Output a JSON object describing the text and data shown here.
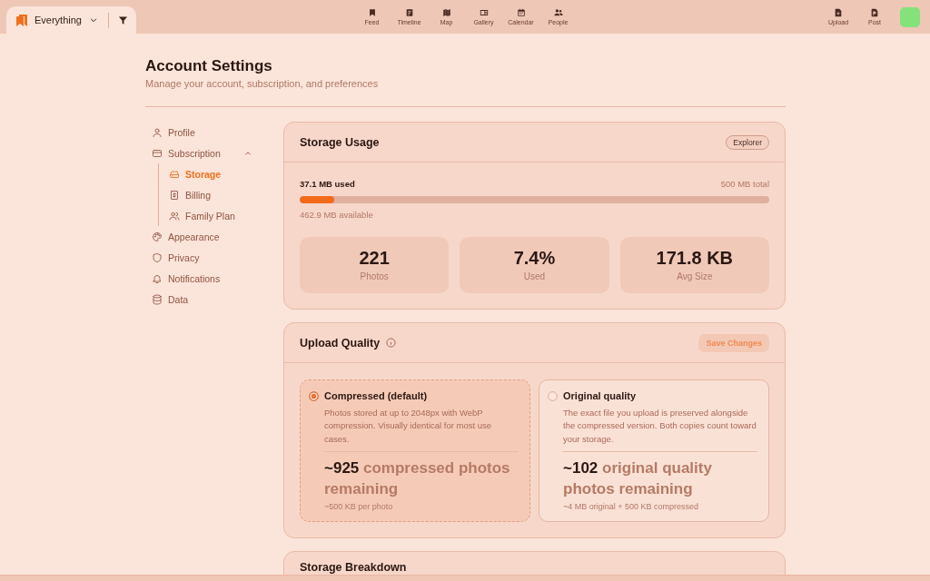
{
  "top_bar": {
    "scope_tab": {
      "label": "Everything"
    },
    "nav_items": [
      {
        "label": "Feed"
      },
      {
        "label": "Timeline"
      },
      {
        "label": "Map"
      },
      {
        "label": "Gallery"
      },
      {
        "label": "Calendar"
      },
      {
        "label": "People"
      }
    ],
    "actions": [
      {
        "label": "Upload"
      },
      {
        "label": "Post"
      }
    ]
  },
  "page": {
    "title": "Account Settings",
    "subtitle": "Manage your account, subscription, and preferences"
  },
  "sidebar": {
    "items": [
      {
        "label": "Profile",
        "selected": false
      },
      {
        "label": "Subscription",
        "selected": false,
        "expanded": true,
        "children": [
          {
            "label": "Storage",
            "selected": true
          },
          {
            "label": "Billing",
            "selected": false
          },
          {
            "label": "Family Plan",
            "selected": false
          }
        ]
      },
      {
        "label": "Appearance",
        "selected": false
      },
      {
        "label": "Privacy",
        "selected": false
      },
      {
        "label": "Notifications",
        "selected": false
      },
      {
        "label": "Data",
        "selected": false
      }
    ]
  },
  "storage_usage": {
    "title": "Storage Usage",
    "plan_badge": "Explorer",
    "used": "37.1 MB used",
    "total": "500 MB total",
    "level": 0.074,
    "available": "462.9 MB available",
    "stats": [
      {
        "value": "221",
        "label": "Photos"
      },
      {
        "value": "7.4%",
        "label": "Used"
      },
      {
        "value": "171.8 KB",
        "label": "Avg Size"
      }
    ]
  },
  "upload_quality": {
    "title": "Upload Quality",
    "save_button": {
      "label": "Save Changes",
      "disabled": true
    },
    "options": [
      {
        "title": "Compressed (default)",
        "selected": true,
        "description": "Photos stored at up to 2048px with WebP compression. Visually identical for most use cases.",
        "estimate": "**~925** compressed photos remaining",
        "note": "~500 KB per photo"
      },
      {
        "title": "Original quality",
        "selected": false,
        "description": "The exact file you upload is preserved alongside the compressed version. Both copies count toward your storage.",
        "estimate": "**~102** original quality photos remaining",
        "note": "~4 MB original + 500 KB compressed"
      }
    ]
  },
  "storage_breakdown": {
    "title": "Storage Breakdown"
  }
}
